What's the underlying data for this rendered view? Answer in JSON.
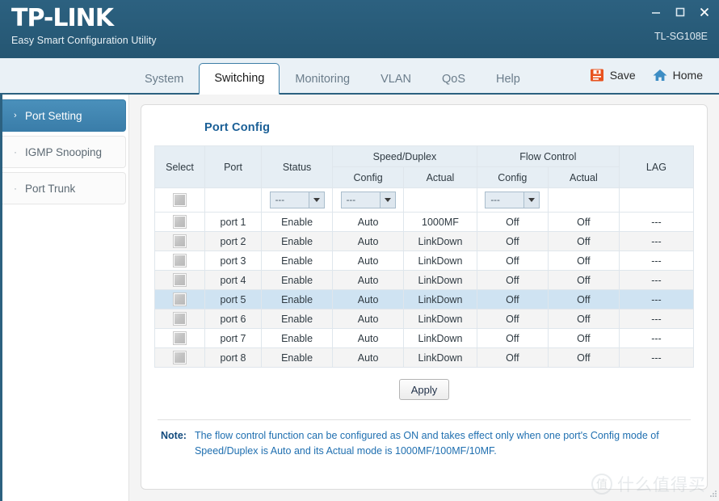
{
  "titlebar": {
    "logo": "TP-LINK",
    "subtitle": "Easy Smart Configuration Utility",
    "model": "TL-SG108E",
    "minimize_label": "Minimize",
    "maximize_label": "Maximize",
    "close_label": "Close"
  },
  "tabs": [
    {
      "label": "System",
      "active": false
    },
    {
      "label": "Switching",
      "active": true
    },
    {
      "label": "Monitoring",
      "active": false
    },
    {
      "label": "VLAN",
      "active": false
    },
    {
      "label": "QoS",
      "active": false
    },
    {
      "label": "Help",
      "active": false
    }
  ],
  "actions": {
    "save_label": "Save",
    "home_label": "Home",
    "save_icon_color": "#e8531f",
    "home_icon_color": "#3d8dc4"
  },
  "sidebar": {
    "items": [
      {
        "label": "Port Setting",
        "marker": "›",
        "active": true
      },
      {
        "label": "IGMP Snooping",
        "marker": "·",
        "active": false
      },
      {
        "label": "Port Trunk",
        "marker": "·",
        "active": false
      }
    ]
  },
  "panel": {
    "title": "Port Config",
    "title_color": "#1a5f96"
  },
  "table": {
    "headers": {
      "select": "Select",
      "port": "Port",
      "status": "Status",
      "speed_duplex": "Speed/Duplex",
      "flow_control": "Flow Control",
      "lag": "LAG",
      "config": "Config",
      "actual": "Actual"
    },
    "filter_row": {
      "status_value": "---",
      "speed_config_value": "---",
      "flow_config_value": "---"
    },
    "rows": [
      {
        "port": "port 1",
        "status": "Enable",
        "speed_config": "Auto",
        "speed_actual": "1000MF",
        "flow_config": "Off",
        "flow_actual": "Off",
        "lag": "---",
        "selected": false
      },
      {
        "port": "port 2",
        "status": "Enable",
        "speed_config": "Auto",
        "speed_actual": "LinkDown",
        "flow_config": "Off",
        "flow_actual": "Off",
        "lag": "---",
        "selected": false
      },
      {
        "port": "port 3",
        "status": "Enable",
        "speed_config": "Auto",
        "speed_actual": "LinkDown",
        "flow_config": "Off",
        "flow_actual": "Off",
        "lag": "---",
        "selected": false
      },
      {
        "port": "port 4",
        "status": "Enable",
        "speed_config": "Auto",
        "speed_actual": "LinkDown",
        "flow_config": "Off",
        "flow_actual": "Off",
        "lag": "---",
        "selected": false
      },
      {
        "port": "port 5",
        "status": "Enable",
        "speed_config": "Auto",
        "speed_actual": "LinkDown",
        "flow_config": "Off",
        "flow_actual": "Off",
        "lag": "---",
        "selected": true
      },
      {
        "port": "port 6",
        "status": "Enable",
        "speed_config": "Auto",
        "speed_actual": "LinkDown",
        "flow_config": "Off",
        "flow_actual": "Off",
        "lag": "---",
        "selected": false
      },
      {
        "port": "port 7",
        "status": "Enable",
        "speed_config": "Auto",
        "speed_actual": "LinkDown",
        "flow_config": "Off",
        "flow_actual": "Off",
        "lag": "---",
        "selected": false
      },
      {
        "port": "port 8",
        "status": "Enable",
        "speed_config": "Auto",
        "speed_actual": "LinkDown",
        "flow_config": "Off",
        "flow_actual": "Off",
        "lag": "---",
        "selected": false
      }
    ]
  },
  "apply": {
    "label": "Apply"
  },
  "note": {
    "label": "Note:",
    "line1": "The flow control function can be configured as ON and takes effect only when one port's",
    "line2": "Config mode of Speed/Duplex is Auto and its Actual mode is 1000MF/100MF/10MF."
  },
  "watermark": {
    "badge": "值",
    "text": "什么值得买"
  }
}
